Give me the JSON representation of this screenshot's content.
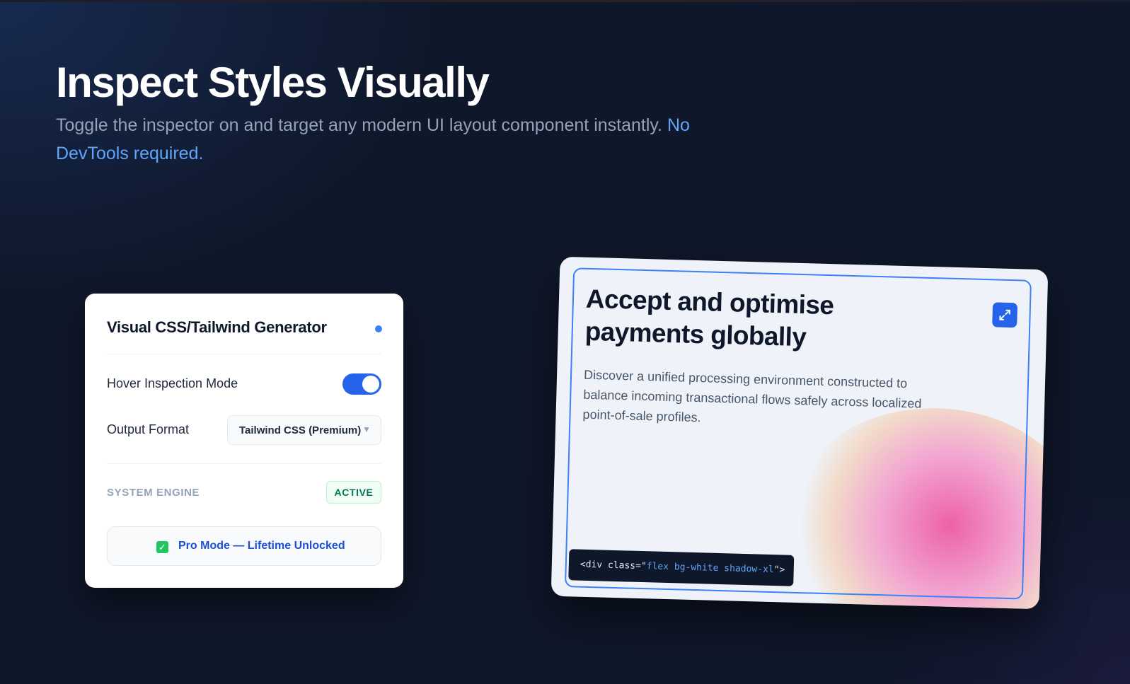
{
  "hero": {
    "title": "Inspect Styles Visually",
    "subtitle": "Toggle the inspector on and target any modern UI layout component instantly.",
    "subtitle_accent": "No DevTools required.",
    "accent_color": "#60a5fa"
  },
  "generator_card": {
    "title": "Visual CSS/Tailwind Generator",
    "hover_label": "Hover Inspection Mode",
    "hover_enabled": true,
    "output_label": "Output Format",
    "output_value": "Tailwind CSS (Premium)",
    "engine_label": "SYSTEM ENGINE",
    "engine_status": "ACTIVE",
    "pro_text": "Pro Mode — Lifetime Unlocked",
    "pro_icon": "check-box-icon"
  },
  "payment_card": {
    "title": "Accept and optimise payments globally",
    "description": "Discover a unified processing environment constructed to balance incoming transactional flows safely across localized point-of-sale profiles.",
    "expand_icon": "expand-icon",
    "code_prefix": "<div class=\"",
    "code_classes": "flex bg-white shadow-xl",
    "code_suffix": "\">"
  },
  "colors": {
    "background": "#0f172a",
    "primary": "#2563eb",
    "success": "#047857"
  }
}
